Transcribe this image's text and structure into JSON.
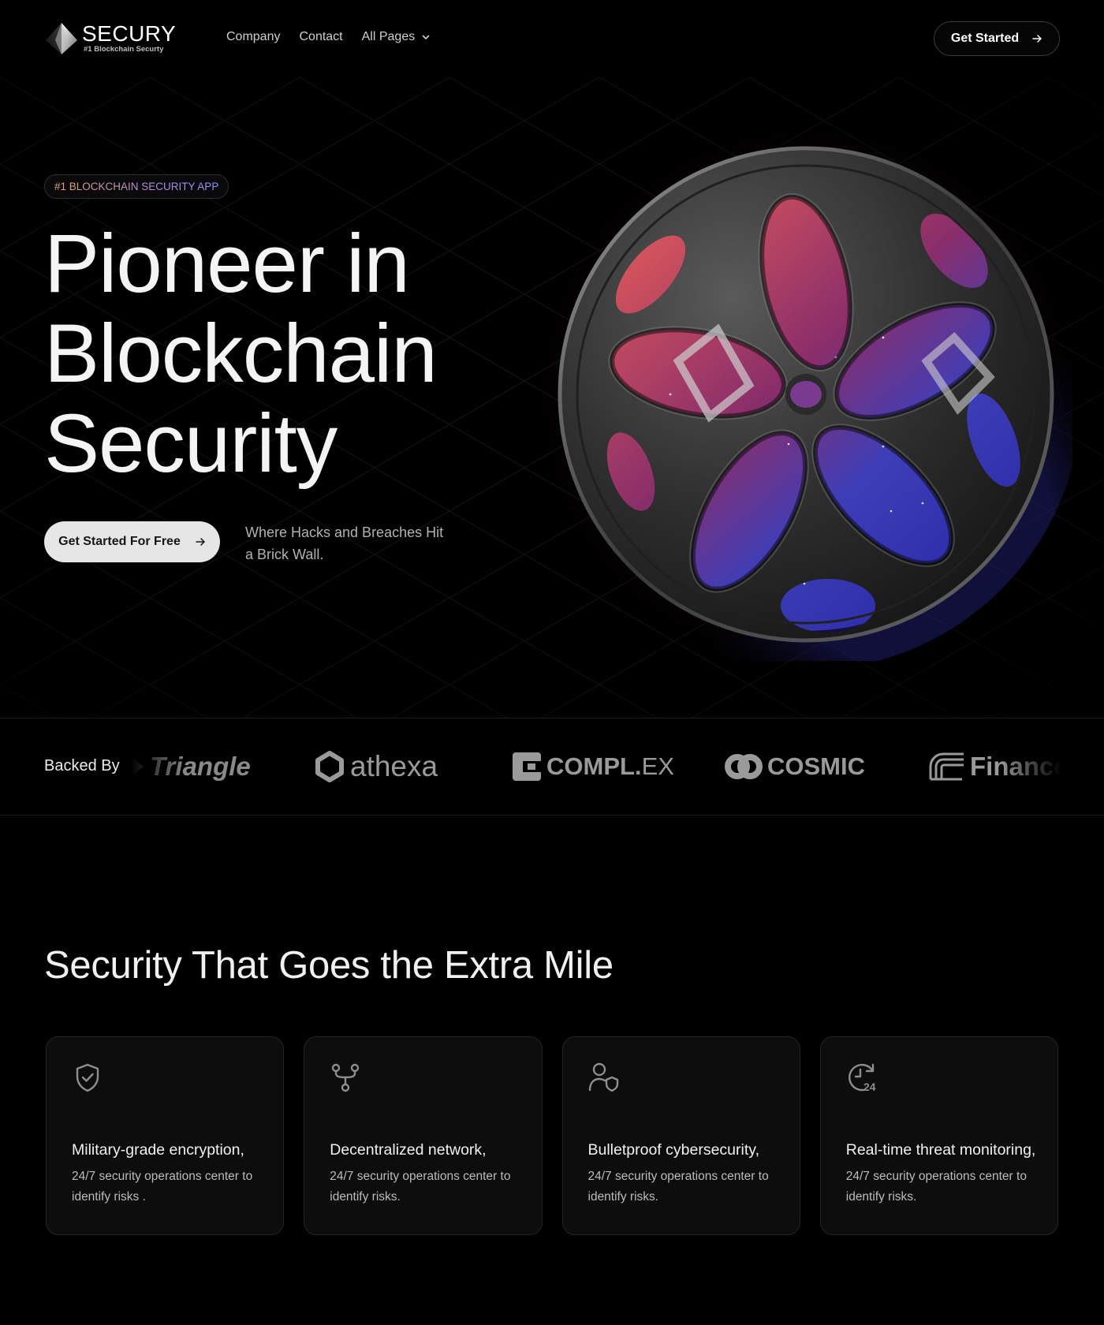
{
  "brand": {
    "name": "SECURY",
    "tagline": "#1 Blockchain Securty"
  },
  "nav": {
    "links": [
      "Company",
      "Contact",
      "All Pages"
    ],
    "cta_label": "Get Started"
  },
  "hero": {
    "badge": "#1 BLOCKCHAIN SECURITY APP",
    "title_lines": [
      "Pioneer in",
      "Blockchain",
      "Security"
    ],
    "cta_label": "Get Started For Free",
    "subtitle": "Where Hacks and Breaches Hit a Brick Wall."
  },
  "backed": {
    "label": "Backed By",
    "partners": {
      "triangle": "Triangle",
      "athexa": "athexa",
      "complex_main": "COMPL.",
      "complex_suffix": "EX",
      "cosmic": "COSMIC",
      "finance": "Finance"
    }
  },
  "features": {
    "title": "Security That Goes the Extra Mile",
    "cards": [
      {
        "icon": "shield-check-icon",
        "title": "Military-grade encryption,",
        "desc": "24/7 security operations center to identify risks ."
      },
      {
        "icon": "network-fork-icon",
        "title": "Decentralized network,",
        "desc": "24/7 security operations center to identify risks."
      },
      {
        "icon": "user-shield-icon",
        "title": "Bulletproof cybersecurity,",
        "desc": "24/7 security operations center to identify risks."
      },
      {
        "icon": "clock-24-icon",
        "title": "Real-time threat monitoring,",
        "desc": "24/7 security operations center to identify risks."
      }
    ]
  },
  "colors": {
    "background": "#000000",
    "card_bg": "#0d0d0d",
    "sphere_red": "#d0454a",
    "sphere_blue": "#3f3fc8",
    "badge_gradient_start": "#e6a36b",
    "badge_gradient_end": "#8f92ff"
  }
}
